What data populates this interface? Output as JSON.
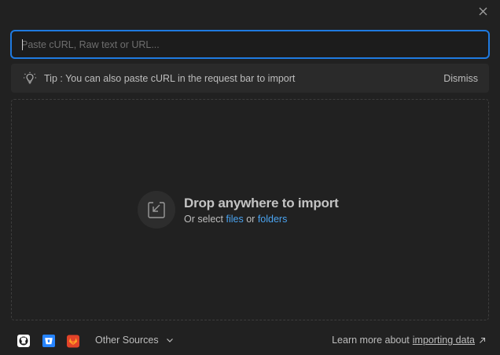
{
  "input": {
    "placeholder": "Paste cURL, Raw text or URL..."
  },
  "tip": {
    "text": "Tip : You can also paste cURL in the request bar to import",
    "dismiss_label": "Dismiss",
    "icon": "lightbulb-icon"
  },
  "drop": {
    "title": "Drop anywhere to import",
    "sub_prefix": "Or select",
    "files_label": "files",
    "or_label": "or",
    "folders_label": "folders",
    "icon": "import-tray-icon"
  },
  "footer": {
    "sources": [
      {
        "name": "github-icon",
        "color": "#ffffff"
      },
      {
        "name": "bitbucket-icon",
        "color": "#2684ff"
      },
      {
        "name": "gitlab-icon",
        "color": "#e24329"
      }
    ],
    "other_sources_label": "Other Sources",
    "learn_prefix": "Learn more about",
    "learn_link": "importing data"
  },
  "colors": {
    "accent": "#1f7ae0",
    "link": "#4aa3f0",
    "background": "#212121"
  }
}
